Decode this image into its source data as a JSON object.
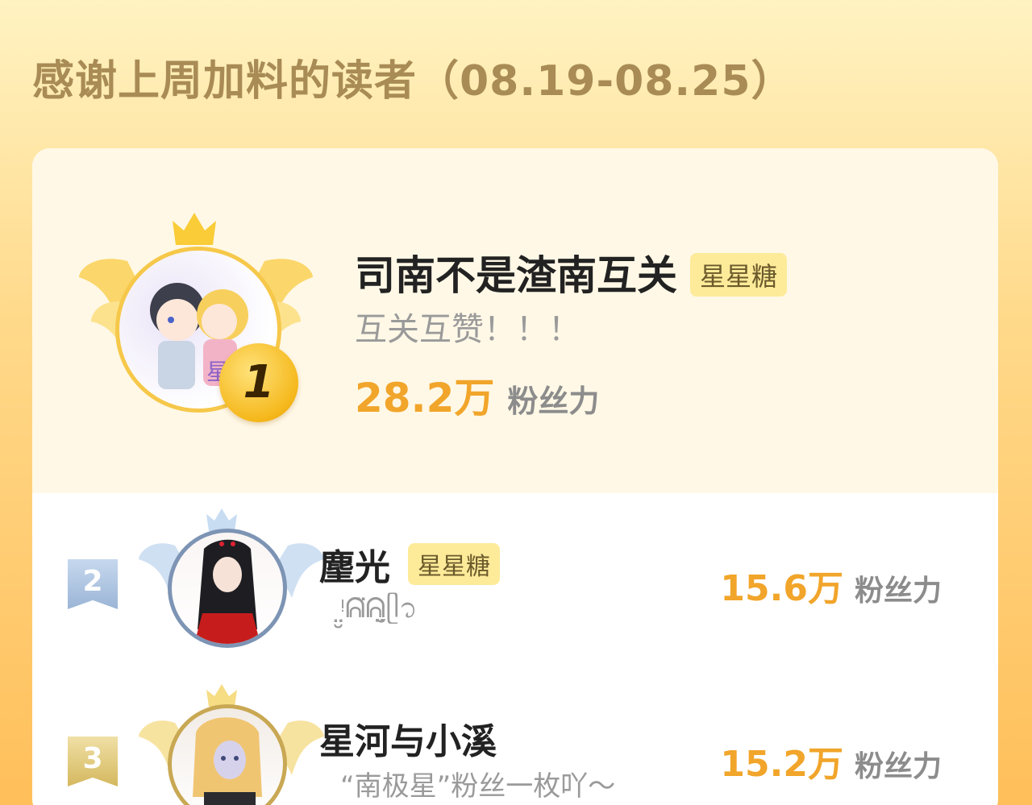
{
  "header": {
    "title": "感谢上周加料的读者（08.19-08.25）"
  },
  "leaderboard": [
    {
      "rank": "1",
      "name": "司南不是渣南互关",
      "badge": "星星糖",
      "signature": "互关互赞！！！",
      "power_value": "28.2万",
      "power_unit": "粉丝力"
    },
    {
      "rank": "2",
      "name": "麈光",
      "badge": "星星糖",
      "signature": "ᵎ̤̮ᕱ̈ᕱ̤̮ᥫ᭡",
      "power_value": "15.6万",
      "power_unit": "粉丝力"
    },
    {
      "rank": "3",
      "name": "星河与小溪",
      "badge": "",
      "signature": "“南极星”粉丝一枚吖～",
      "power_value": "15.2万",
      "power_unit": "粉丝力"
    }
  ],
  "colors": {
    "accent": "#f1a52a",
    "gold": "#f6c84a",
    "silver": "#7d94b4",
    "bronze": "#c9a854"
  }
}
